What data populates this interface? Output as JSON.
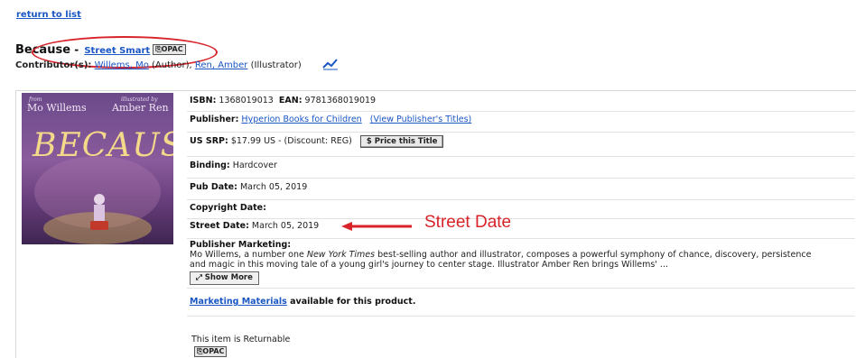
{
  "nav": {
    "return_label": "return to list"
  },
  "product": {
    "title": "Because",
    "separator": " - ",
    "series_link": "Street Smart",
    "opac_label": "OPAC",
    "contributors_label": "Contributor(s):",
    "author_link": "Willems, Mo",
    "author_role": "(Author),",
    "illustrator_link": "Ren, Amber",
    "illustrator_role": "(Illustrator)"
  },
  "cover": {
    "author_top": "Mo Willems",
    "illustrator_top": "Amber Ren",
    "small_left": "from",
    "small_right": "illustrated by",
    "title": "BECAUSE"
  },
  "details": {
    "isbn_label": "ISBN:",
    "isbn": "1368019013",
    "ean_label": "EAN:",
    "ean": "9781368019019",
    "publisher_label": "Publisher:",
    "publisher_link": "Hyperion Books for Children",
    "publisher_titles_link": "(View Publisher's Titles)",
    "srp_label": "US SRP:",
    "srp": "$17.99 US",
    "discount": "- (Discount: REG)",
    "price_button": "$ Price this Title",
    "binding_label": "Binding:",
    "binding": "Hardcover",
    "pubdate_label": "Pub Date:",
    "pubdate": "March 05, 2019",
    "copyright_label": "Copyright Date:",
    "copyright": "",
    "streetdate_label": "Street Date:",
    "streetdate": "March 05, 2019",
    "marketing_label": "Publisher Marketing:",
    "marketing_pre": "Mo Willems, a number one ",
    "marketing_italic": "New York Times",
    "marketing_post": " best-selling author and illustrator, composes a powerful symphony of chance, discovery, persistence",
    "marketing_line2": "and magic in this moving tale of a young girl's journey to center stage. Illustrator Amber Ren brings Willems' ...",
    "show_more": "Show More",
    "materials_link": "Marketing Materials",
    "materials_text": " available for this product.",
    "returnable": "This item is Returnable",
    "opac_label": "OPAC"
  },
  "annotation": {
    "label": "Street Date",
    "color": "#d8232a"
  },
  "colors": {
    "link": "#1a56c4",
    "accent": "#d8232a"
  }
}
